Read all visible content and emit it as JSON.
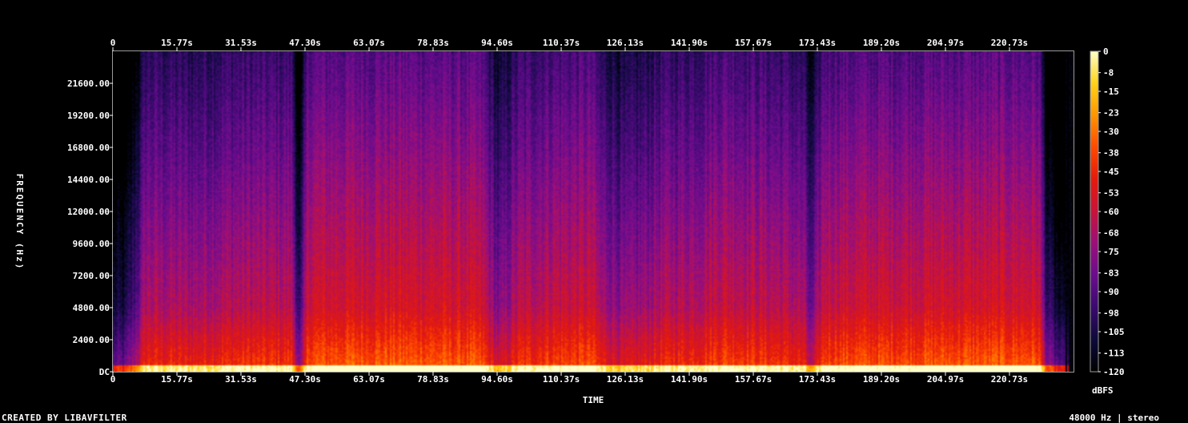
{
  "chart_data": {
    "type": "heatmap",
    "xlabel": "TIME",
    "ylabel": "FREQUENCY (Hz)",
    "x_ticks": [
      "0",
      "15.77s",
      "31.53s",
      "47.30s",
      "63.07s",
      "78.83s",
      "94.60s",
      "110.37s",
      "126.13s",
      "141.90s",
      "157.67s",
      "173.43s",
      "189.20s",
      "204.97s",
      "220.73s"
    ],
    "x_tick_values": [
      0,
      15.77,
      31.53,
      47.3,
      63.07,
      78.83,
      94.6,
      110.37,
      126.13,
      141.9,
      157.67,
      173.43,
      189.2,
      204.97,
      220.73
    ],
    "xlim": [
      0,
      236.5
    ],
    "y_ticks": [
      "DC",
      "2400.00",
      "4800.00",
      "7200.00",
      "9600.00",
      "12000.00",
      "14400.00",
      "16800.00",
      "19200.00",
      "21600.00"
    ],
    "y_tick_values": [
      0,
      2400,
      4800,
      7200,
      9600,
      12000,
      14400,
      16800,
      19200,
      21600
    ],
    "ylim": [
      0,
      24000
    ],
    "colorbar": {
      "label": "dBFS",
      "ticks": [
        "0",
        "-8",
        "-15",
        "-23",
        "-30",
        "-38",
        "-45",
        "-53",
        "-60",
        "-68",
        "-75",
        "-83",
        "-90",
        "-98",
        "-105",
        "-113",
        "-120"
      ],
      "tick_values": [
        0,
        -8,
        -15,
        -23,
        -30,
        -38,
        -45,
        -53,
        -60,
        -68,
        -75,
        -83,
        -90,
        -98,
        -105,
        -113,
        -120
      ],
      "range": [
        -120,
        0
      ],
      "colormap": [
        "#000000",
        "#0d0a3a",
        "#3a0a6e",
        "#6a0c8e",
        "#9a0f7a",
        "#c8133a",
        "#e41a0c",
        "#ff4a00",
        "#ff9500",
        "#ffd21a",
        "#ffffc8"
      ]
    },
    "activity_profile": {
      "note_times": [
        0,
        3,
        7,
        8,
        20,
        30,
        44,
        46,
        48,
        70,
        88,
        91,
        95,
        100,
        108,
        118,
        120,
        126,
        135,
        145,
        150,
        165,
        170,
        172,
        175,
        200,
        220,
        228,
        230,
        236.5
      ],
      "level": [
        -100,
        -100,
        -70,
        -58,
        -60,
        -56,
        -55,
        -95,
        -48,
        -46,
        -48,
        -50,
        -72,
        -56,
        -52,
        -50,
        -60,
        -68,
        -58,
        -55,
        -50,
        -56,
        -60,
        -80,
        -50,
        -48,
        -47,
        -48,
        -90,
        -120
      ]
    }
  },
  "footer": {
    "left": "CREATED BY LIBAVFILTER",
    "right": "48000 Hz | stereo"
  }
}
